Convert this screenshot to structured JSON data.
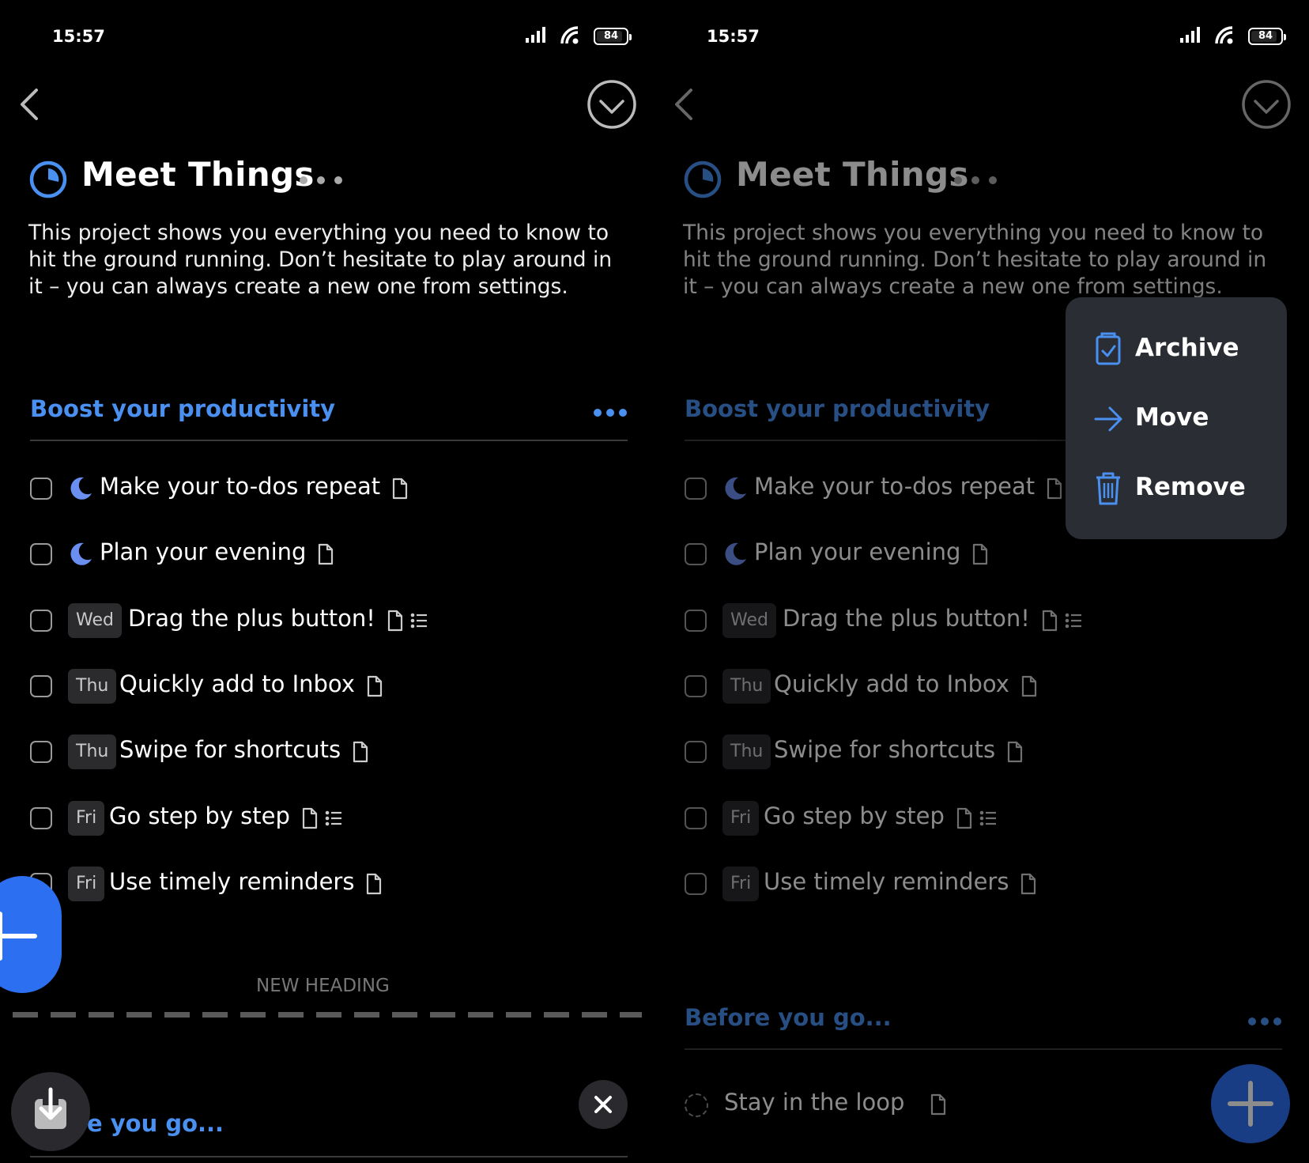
{
  "status_bar": {
    "time": "15:57",
    "battery": "84"
  },
  "project": {
    "title": "Meet Things",
    "description": "This project shows you everything you need to know to hit the ground running. Don’t hesitate to play around in it – you can always create a new one from settings."
  },
  "heading1": "Boost your productivity",
  "heading2": "Before you go...",
  "heading2_partial": "e you go...",
  "new_heading": "NEW HEADING",
  "tasks": [
    {
      "label": "Make your to-dos repeat",
      "badge": null,
      "icon": "moon-icon",
      "checklist": false
    },
    {
      "label": "Plan your evening",
      "badge": null,
      "icon": "moon-icon",
      "checklist": false
    },
    {
      "label": "Drag the plus button!",
      "badge": "Wed",
      "checklist": true
    },
    {
      "label": "Quickly add to Inbox",
      "badge": "Thu",
      "checklist": false
    },
    {
      "label": "Swipe for shortcuts",
      "badge": "Thu",
      "checklist": false
    },
    {
      "label": "Go step by step",
      "badge": "Fri",
      "checklist": true
    },
    {
      "label": "Use timely reminders",
      "badge": "Fri",
      "checklist": false
    }
  ],
  "after_task": {
    "label": "Stay in the loop"
  },
  "menu": {
    "archive": "Archive",
    "move": "Move",
    "remove": "Remove"
  },
  "colors": {
    "accent": "#4a90f0",
    "fab": "#2c6ff0",
    "menu_bg": "#2a2d33",
    "badge_bg": "#2b2b2e"
  },
  "icons": [
    "back-icon",
    "done-circle-icon",
    "project-progress-icon",
    "more-icon",
    "note-icon",
    "checklist-icon",
    "plus-icon",
    "import-icon",
    "close-icon",
    "archive-icon",
    "move-arrow-icon",
    "trash-icon"
  ]
}
